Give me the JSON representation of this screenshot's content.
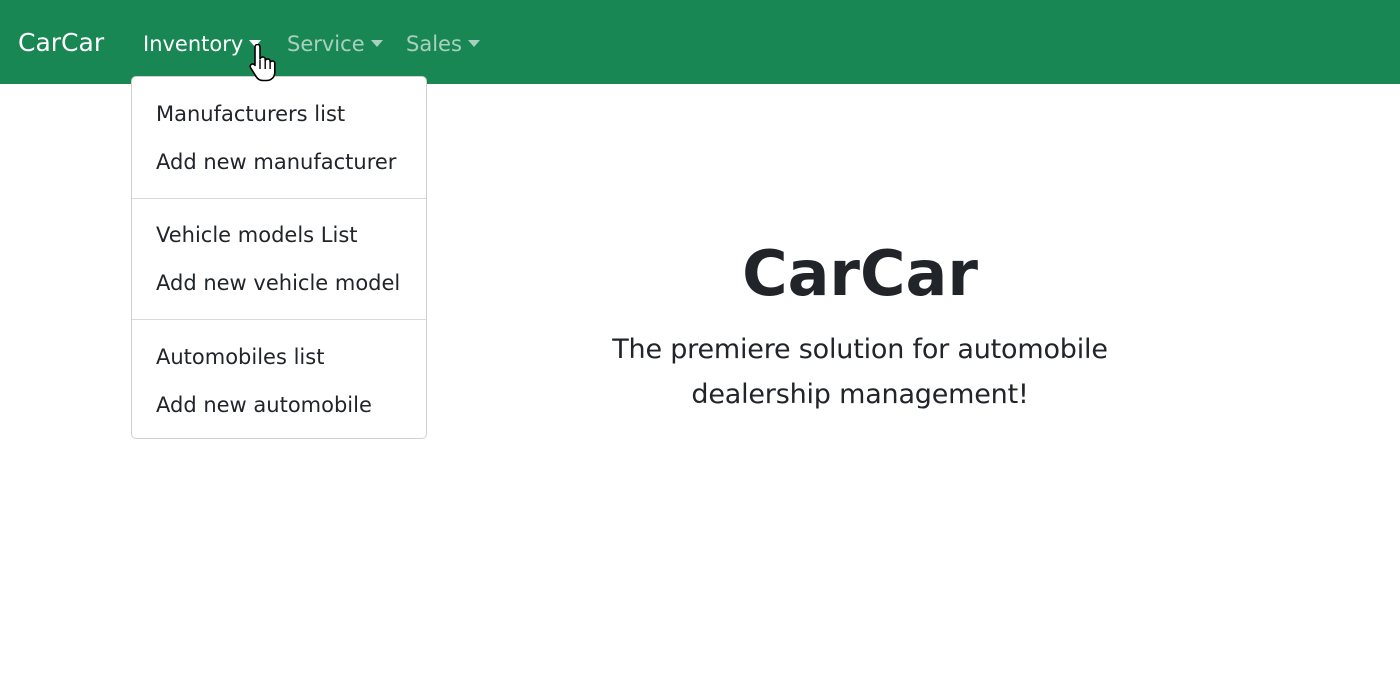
{
  "navbar": {
    "brand": "CarCar",
    "bg_color": "#198754",
    "items": [
      {
        "label": "Inventory",
        "icon": "caret-down-icon",
        "state": "open"
      },
      {
        "label": "Service",
        "icon": "caret-down-icon"
      },
      {
        "label": "Sales",
        "icon": "caret-down-icon"
      }
    ]
  },
  "dropdown": {
    "groups": [
      {
        "items": [
          "Manufacturers list",
          "Add new manufacturer"
        ]
      },
      {
        "items": [
          "Vehicle models List",
          "Add new vehicle model"
        ]
      },
      {
        "items": [
          "Automobiles list",
          "Add new automobile"
        ]
      }
    ]
  },
  "hero": {
    "title": "CarCar",
    "lead": "The premiere solution for automobile dealership management!"
  },
  "cursor": {
    "icon": "hand-pointer-cursor-icon"
  }
}
